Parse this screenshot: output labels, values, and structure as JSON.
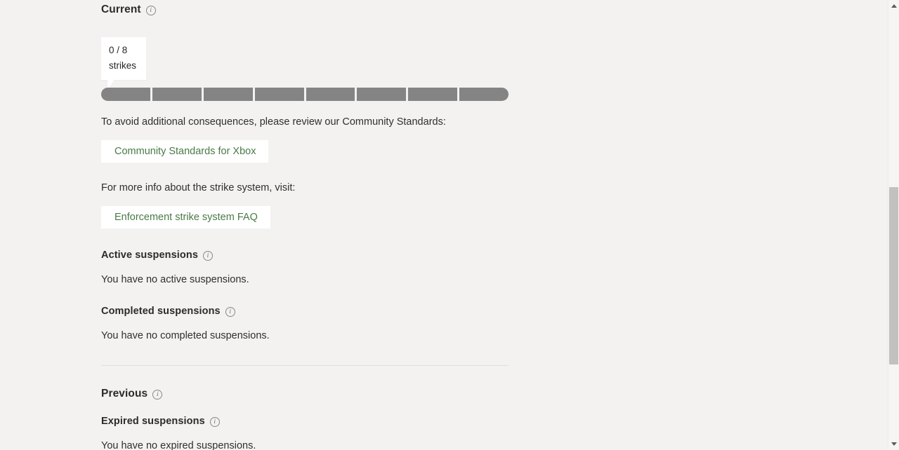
{
  "sections": {
    "current": {
      "title": "Current",
      "info_icon": "info-circle-icon",
      "callout": {
        "count_line": "0 / 8",
        "unit_line": "strikes"
      },
      "meter": {
        "total": 8,
        "used": 0,
        "segment_color": "#848484"
      },
      "community_prompt": "To avoid additional consequences, please review our Community Standards:",
      "community_link_label": "Community Standards for Xbox",
      "faq_prompt": "For more info about the strike system, visit:",
      "faq_link_label": "Enforcement strike system FAQ",
      "active_suspensions": {
        "title": "Active suspensions",
        "body": "You have no active suspensions."
      },
      "completed_suspensions": {
        "title": "Completed suspensions",
        "body": "You have no completed suspensions."
      }
    },
    "previous": {
      "title": "Previous",
      "expired_suspensions": {
        "title": "Expired suspensions",
        "body": "You have no expired suspensions."
      }
    }
  },
  "scrollbar": {
    "up_arrow": "scroll-up-arrow-icon",
    "down_arrow": "scroll-down-arrow-icon"
  },
  "colors": {
    "page_background": "#f3f2f1",
    "link_text": "#4a7a47",
    "meter_segment": "#848484",
    "heading_text": "#2b2b2b"
  }
}
